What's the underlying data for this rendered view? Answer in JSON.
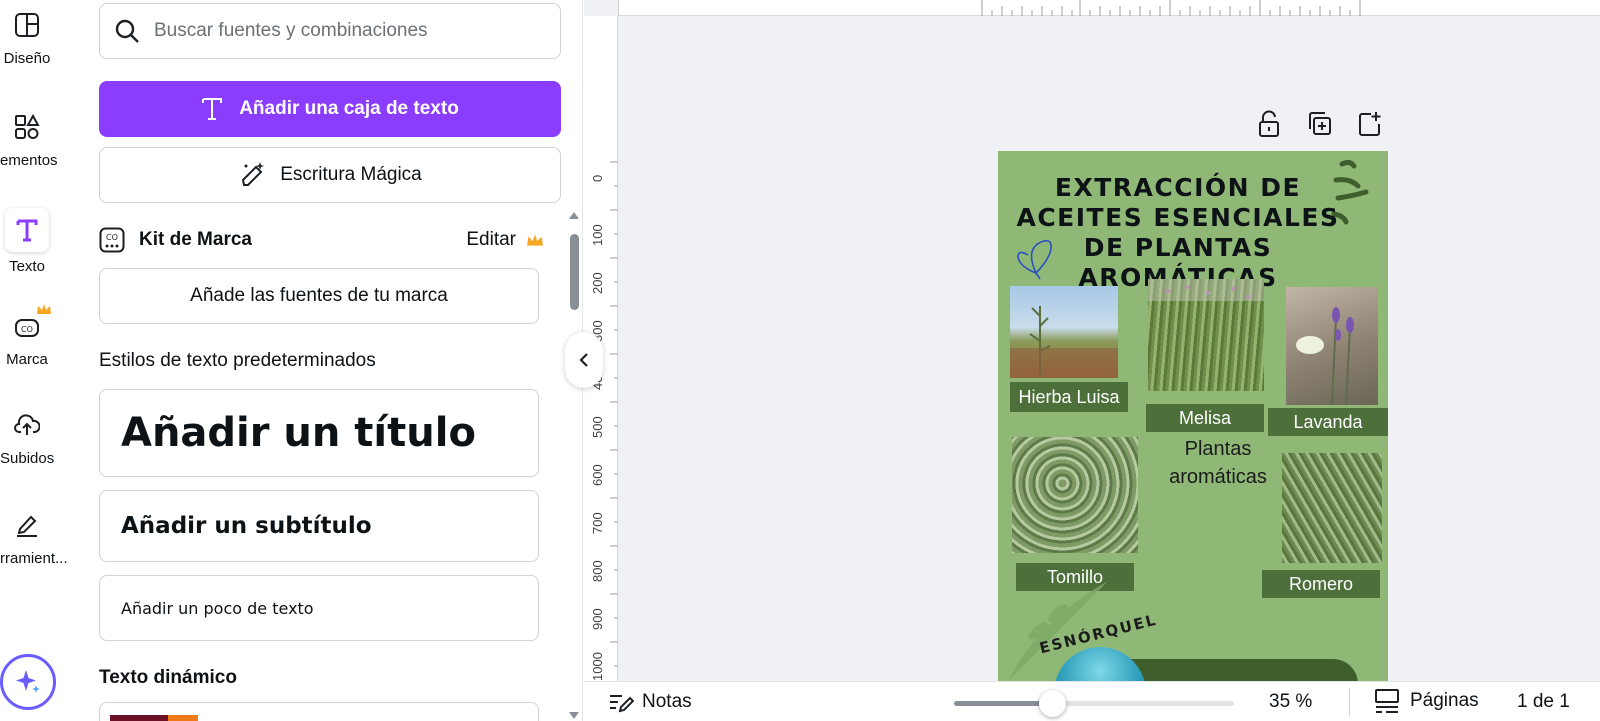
{
  "rail": {
    "items": [
      {
        "label": "Diseño",
        "icon": "layout-icon"
      },
      {
        "label": "ementos",
        "icon": "elements-icon"
      },
      {
        "label": "Texto",
        "icon": "text-icon"
      },
      {
        "label": "Marca",
        "icon": "brand-icon"
      },
      {
        "label": "Subidos",
        "icon": "upload-icon"
      },
      {
        "label": "rramient...",
        "icon": "tools-icon"
      }
    ]
  },
  "panel": {
    "search_placeholder": "Buscar fuentes y combinaciones",
    "add_textbox": "Añadir una caja de texto",
    "magic_write": "Escritura Mágica",
    "brand_kit": "Kit de Marca",
    "edit": "Editar",
    "add_brand_fonts": "Añade las fuentes de tu marca",
    "default_styles_title": "Estilos de texto predeterminados",
    "add_title": "Añadir un título",
    "add_subtitle": "Añadir un subtítulo",
    "add_body": "Añadir un poco de texto",
    "dynamic_text": "Texto dinámico"
  },
  "ruler": {
    "left_marks": [
      "0",
      "100",
      "200",
      "300",
      "400",
      "500",
      "600",
      "700",
      "800",
      "900",
      "1000"
    ]
  },
  "design": {
    "title": "EXTRACCIÓN DE ACEITES ESENCIALES DE PLANTAS AROMÁTICAS",
    "labels": {
      "hierba": "Hierba Luisa",
      "melisa": "Melisa",
      "lavanda": "Lavanda",
      "tomillo": "Tomillo",
      "romero": "Romero"
    },
    "center_text": "Plantas aromáticas",
    "arc_text": "ESNÓRQUEL"
  },
  "bottom": {
    "notes": "Notas",
    "zoom": "35 %",
    "zoom_fraction": 0.35,
    "pages": "Páginas",
    "page_count": "1 de 1"
  },
  "colors": {
    "accent": "#8b3dff",
    "design_bg": "#8fb877",
    "label_bg": "#4d6f3a"
  }
}
